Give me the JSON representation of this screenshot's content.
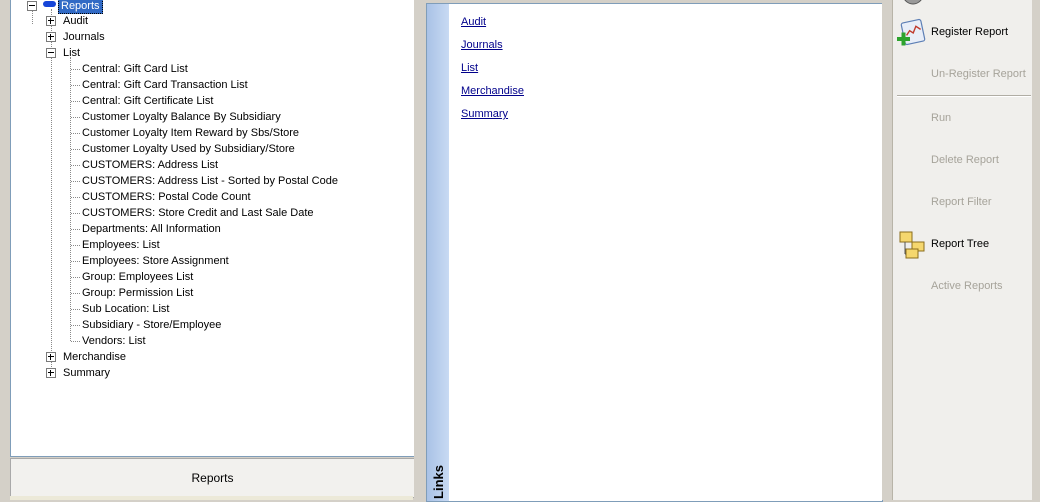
{
  "tree": {
    "root": "Reports",
    "nodes": [
      {
        "label": "Audit",
        "expanded": false
      },
      {
        "label": "Journals",
        "expanded": false
      },
      {
        "label": "List",
        "expanded": true,
        "children": [
          "Central: Gift Card List",
          "Central: Gift Card Transaction List",
          "Central: Gift Certificate List",
          "Customer Loyalty Balance By Subsidiary",
          "Customer Loyalty Item Reward by Sbs/Store",
          "Customer Loyalty Used by Subsidiary/Store",
          "CUSTOMERS: Address List",
          "CUSTOMERS: Address List - Sorted by Postal Code",
          "CUSTOMERS: Postal Code Count",
          "CUSTOMERS: Store Credit and Last Sale Date",
          "Departments: All Information",
          "Employees: List",
          "Employees: Store Assignment",
          "Group: Employees List",
          "Group: Permission List",
          "Sub Location: List",
          "Subsidiary - Store/Employee",
          "Vendors: List"
        ]
      },
      {
        "label": "Merchandise",
        "expanded": false
      },
      {
        "label": "Summary",
        "expanded": false
      }
    ]
  },
  "bottom_tab": {
    "label": "Reports"
  },
  "links": {
    "strip_label": "Links",
    "items": [
      "Audit",
      "Journals",
      "List",
      "Merchandise",
      "Summary"
    ]
  },
  "actions": [
    {
      "label": "Register Report",
      "enabled": true,
      "icon": "register-report-icon"
    },
    {
      "label": "Un-Register Report",
      "enabled": false
    },
    {
      "label": "Run",
      "enabled": false
    },
    {
      "label": "Delete Report",
      "enabled": false
    },
    {
      "label": "Report Filter",
      "enabled": false
    },
    {
      "label": "Report Tree",
      "enabled": true,
      "icon": "report-tree-icon"
    },
    {
      "label": "Active Reports",
      "enabled": false
    }
  ],
  "colors": {
    "selection": "#316ac5",
    "link": "#00008b",
    "disabled": "#a6a39a"
  }
}
